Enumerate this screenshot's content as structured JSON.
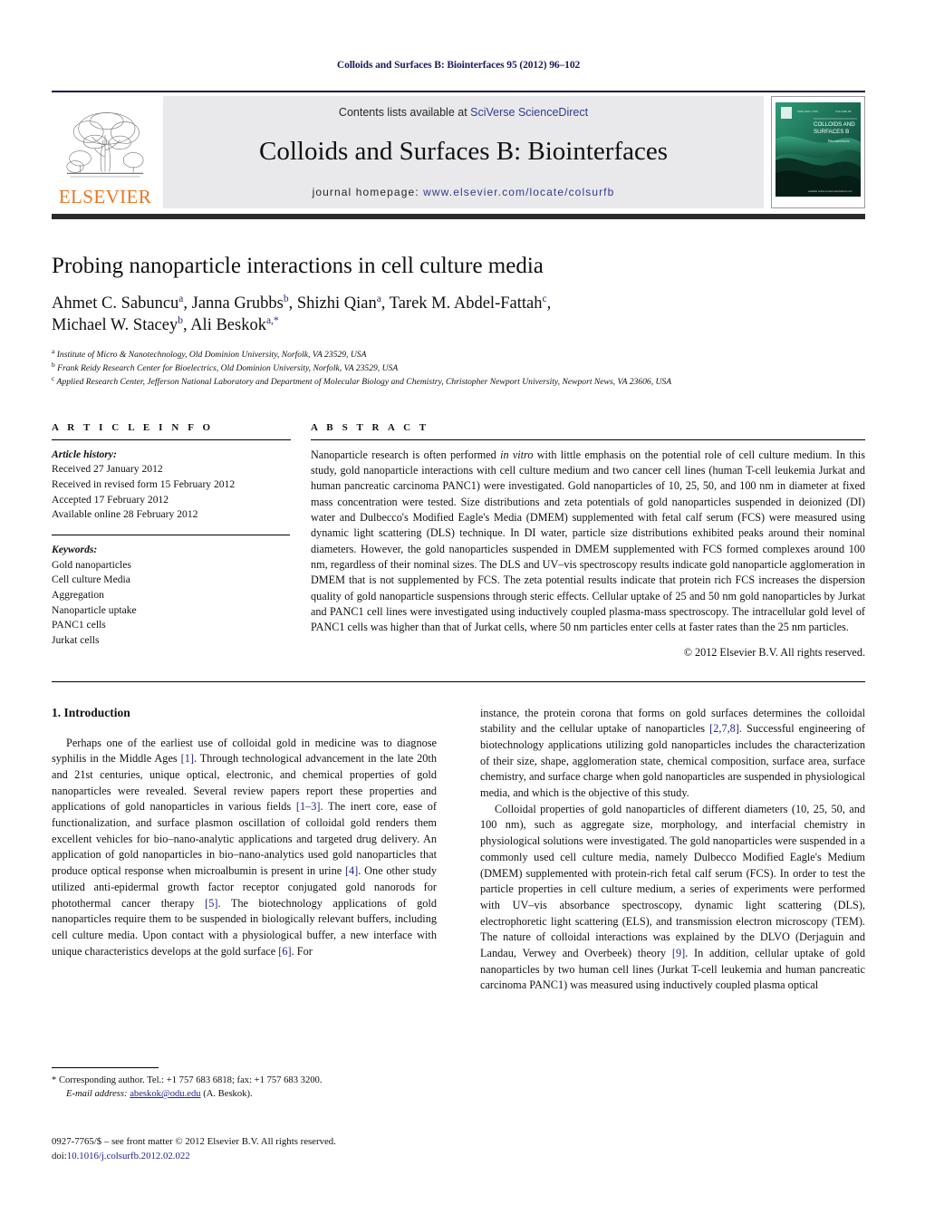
{
  "running_head": "Colloids and Surfaces B: Biointerfaces 95 (2012) 96–102",
  "banner": {
    "publisher_name": "ELSEVIER",
    "contents_prefix": "Contents lists available at ",
    "contents_link": "SciVerse ScienceDirect",
    "journal_title": "Colloids and Surfaces B: Biointerfaces",
    "homepage_prefix": "journal homepage: ",
    "homepage_url": "www.elsevier.com/locate/colsurfb",
    "cover": {
      "title_line1": "COLLOIDS AND",
      "title_line2": "SURFACES B",
      "subtitle": "Biointerfaces",
      "top_label": "ISSN 0927-7765    VOLUME 95",
      "bottom_label": "available online at www.sciencedirect.com",
      "accent_color": "#1f7a5a"
    }
  },
  "article": {
    "title": "Probing nanoparticle interactions in cell culture media",
    "authors_line1": "Ahmet C. Sabuncu<sup>a</sup>, Janna Grubbs<sup>b</sup>, Shizhi Qian<sup>a</sup>, Tarek M. Abdel-Fattah<sup>c</sup>,",
    "authors_line2": "Michael W. Stacey<sup>b</sup>, Ali Beskok<sup>a,</sup><sup>*</sup>",
    "affiliations": [
      "<sup>a</sup> Institute of Micro &amp; Nanotechnology, Old Dominion University, Norfolk, VA 23529, USA",
      "<sup>b</sup> Frank Reidy Research Center for Bioelectrics, Old Dominion University, Norfolk, VA 23529, USA",
      "<sup>c</sup> Applied Research Center, Jefferson National Laboratory and Department of Molecular Biology and Chemistry, Christopher Newport University, Newport News, VA 23606, USA"
    ]
  },
  "article_info": {
    "heading": "A R T I C L E   I N F O",
    "history_label": "Article history:",
    "history": [
      "Received 27 January 2012",
      "Received in revised form 15 February 2012",
      "Accepted 17 February 2012",
      "Available online 28 February 2012"
    ],
    "keywords_label": "Keywords:",
    "keywords": [
      "Gold nanoparticles",
      "Cell culture Media",
      "Aggregation",
      "Nanoparticle uptake",
      "PANC1 cells",
      "Jurkat cells"
    ]
  },
  "abstract": {
    "heading": "A B S T R A C T",
    "text": "Nanoparticle research is often performed <em>in vitro</em> with little emphasis on the potential role of cell culture medium. In this study, gold nanoparticle interactions with cell culture medium and two cancer cell lines (human T-cell leukemia Jurkat and human pancreatic carcinoma PANC1) were investigated. Gold nanoparticles of 10, 25, 50, and 100 nm in diameter at fixed mass concentration were tested. Size distributions and zeta potentials of gold nanoparticles suspended in deionized (DI) water and Dulbecco's Modified Eagle's Media (DMEM) supplemented with fetal calf serum (FCS) were measured using dynamic light scattering (DLS) technique. In DI water, particle size distributions exhibited peaks around their nominal diameters. However, the gold nanoparticles suspended in DMEM supplemented with FCS formed complexes around 100 nm, regardless of their nominal sizes. The DLS and UV–vis spectroscopy results indicate gold nanoparticle agglomeration in DMEM that is not supplemented by FCS. The zeta potential results indicate that protein rich FCS increases the dispersion quality of gold nanoparticle suspensions through steric effects. Cellular uptake of 25 and 50 nm gold nanoparticles by Jurkat and PANC1 cell lines were investigated using inductively coupled plasma-mass spectroscopy. The intracellular gold level of PANC1 cells was higher than that of Jurkat cells, where 50 nm particles enter cells at faster rates than the 25 nm particles.",
    "copyright": "© 2012 Elsevier B.V. All rights reserved."
  },
  "body": {
    "section_heading": "1.  Introduction",
    "left_paragraphs": [
      "Perhaps one of the earliest use of colloidal gold in medicine was to diagnose syphilis in the Middle Ages <span class=\"ref\">[1]</span>. Through technological advancement in the late 20th and 21st centuries, unique optical, electronic, and chemical properties of gold nanoparticles were revealed. Several review papers report these properties and applications of gold nanoparticles in various fields <span class=\"ref\">[1–3]</span>. The inert core, ease of functionalization, and surface plasmon oscillation of colloidal gold renders them excellent vehicles for bio–nano-analytic applications and targeted drug delivery. An application of gold nanoparticles in bio–nano-analytics used gold nanoparticles that produce optical response when microalbumin is present in urine <span class=\"ref\">[4]</span>. One other study utilized anti-epidermal growth factor receptor conjugated gold nanorods for photothermal cancer therapy <span class=\"ref\">[5]</span>. The biotechnology applications of gold nanoparticles require them to be suspended in biologically relevant buffers, including cell culture media. Upon contact with a physiological buffer, a new interface with unique characteristics develops at the gold surface <span class=\"ref\">[6]</span>. For"
    ],
    "right_paragraphs": [
      "instance, the protein corona that forms on gold surfaces determines the colloidal stability and the cellular uptake of nanoparticles <span class=\"ref\">[2,7,8]</span>. Successful engineering of biotechnology applications utilizing gold nanoparticles includes the characterization of their size, shape, agglomeration state, chemical composition, surface area, surface chemistry, and surface charge when gold nanoparticles are suspended in physiological media, and which is the objective of this study.",
      "Colloidal properties of gold nanoparticles of different diameters (10, 25, 50, and 100 nm), such as aggregate size, morphology, and interfacial chemistry in physiological solutions were investigated. The gold nanoparticles were suspended in a commonly used cell culture media, namely Dulbecco Modified Eagle's Medium (DMEM) supplemented with protein-rich fetal calf serum (FCS). In order to test the particle properties in cell culture medium, a series of experiments were performed with UV–vis absorbance spectroscopy, dynamic light scattering (DLS), electrophoretic light scattering (ELS), and transmission electron microscopy (TEM). The nature of colloidal interactions was explained by the DLVO (Derjaguin and Landau, Verwey and Overbeek) theory <span class=\"ref\">[9]</span>. In addition, cellular uptake of gold nanoparticles by two human cell lines (Jurkat T-cell leukemia and human pancreatic carcinoma PANC1) was measured using inductively coupled plasma optical"
    ]
  },
  "footer": {
    "corresponding": "*  Corresponding author. Tel.: +1 757 683 6818; fax: +1 757 683 3200.",
    "email_label": "E-mail address:",
    "email": "abeskok@odu.edu",
    "email_suffix": " (A. Beskok).",
    "issn_line": "0927-7765/$ – see front matter © 2012 Elsevier B.V. All rights reserved.",
    "doi_label": "doi:",
    "doi": "10.1016/j.colsurfb.2012.02.022"
  }
}
